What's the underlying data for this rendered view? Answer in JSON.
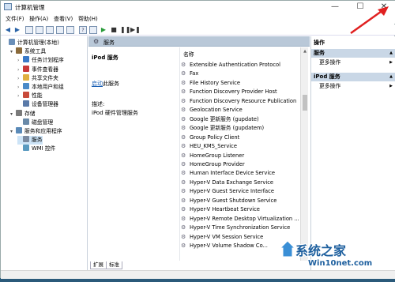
{
  "window": {
    "title": "计算机管理"
  },
  "menu": [
    "文件(F)",
    "操作(A)",
    "查看(V)",
    "帮助(H)"
  ],
  "tree": [
    {
      "label": "计算机管理(本地)",
      "icon": "computer-icon",
      "indent": 0,
      "arrow": ""
    },
    {
      "label": "系统工具",
      "icon": "tools-icon",
      "indent": 1,
      "arrow": "v"
    },
    {
      "label": "任务计划程序",
      "icon": "clock-icon",
      "indent": 2,
      "arrow": ">"
    },
    {
      "label": "事件查看器",
      "icon": "event-viewer-icon",
      "indent": 2,
      "arrow": ">"
    },
    {
      "label": "共享文件夹",
      "icon": "folder-icon",
      "indent": 2,
      "arrow": ">"
    },
    {
      "label": "本地用户和组",
      "icon": "users-icon",
      "indent": 2,
      "arrow": ">"
    },
    {
      "label": "性能",
      "icon": "performance-icon",
      "indent": 2,
      "arrow": ">"
    },
    {
      "label": "设备管理器",
      "icon": "device-manager-icon",
      "indent": 2,
      "arrow": ""
    },
    {
      "label": "存储",
      "icon": "storage-icon",
      "indent": 1,
      "arrow": "v"
    },
    {
      "label": "磁盘管理",
      "icon": "disk-icon",
      "indent": 2,
      "arrow": ""
    },
    {
      "label": "服务和应用程序",
      "icon": "services-apps-icon",
      "indent": 1,
      "arrow": "v"
    },
    {
      "label": "服务",
      "icon": "gear-icon",
      "indent": 2,
      "arrow": "",
      "selected": true
    },
    {
      "label": "WMI 控件",
      "icon": "wmi-icon",
      "indent": 2,
      "arrow": ""
    }
  ],
  "panel": {
    "header": "服务"
  },
  "detail": {
    "service_name": "iPod 服务",
    "start_link": "启动",
    "start_suffix": "此服务",
    "desc_label": "描述:",
    "desc_value": "iPod 硬件管理服务"
  },
  "list": {
    "column_header": "名称",
    "rows": [
      "Extensible Authentication Protocol",
      "Fax",
      "File History Service",
      "Function Discovery Provider Host",
      "Function Discovery Resource Publication",
      "Geolocation Service",
      "Google 更新服务 (gupdate)",
      "Google 更新服务 (gupdatem)",
      "Group Policy Client",
      "HEU_KMS_Service",
      "HomeGroup Listener",
      "HomeGroup Provider",
      "Human Interface Device Service",
      "Hyper-V Data Exchange Service",
      "Hyper-V Guest Service Interface",
      "Hyper-V Guest Shutdown Service",
      "Hyper-V Heartbeat Service",
      "Hyper-V Remote Desktop Virtualization ...",
      "Hyper-V Time Synchronization Service",
      "Hyper-V VM Session Service",
      "Hyper-V Volume Shadow Co..."
    ]
  },
  "tabs": [
    "扩展",
    "标准"
  ],
  "actions": {
    "header": "操作",
    "sections": [
      {
        "title": "服务",
        "item": "更多操作"
      },
      {
        "title": "iPod 服务",
        "item": "更多操作"
      }
    ]
  },
  "watermark": {
    "line1": "系统之家",
    "line2": "Win10net.com"
  },
  "colors": {
    "accent": "#1d5f9e",
    "selection": "#cde4f7",
    "arrow": "#e02020"
  }
}
